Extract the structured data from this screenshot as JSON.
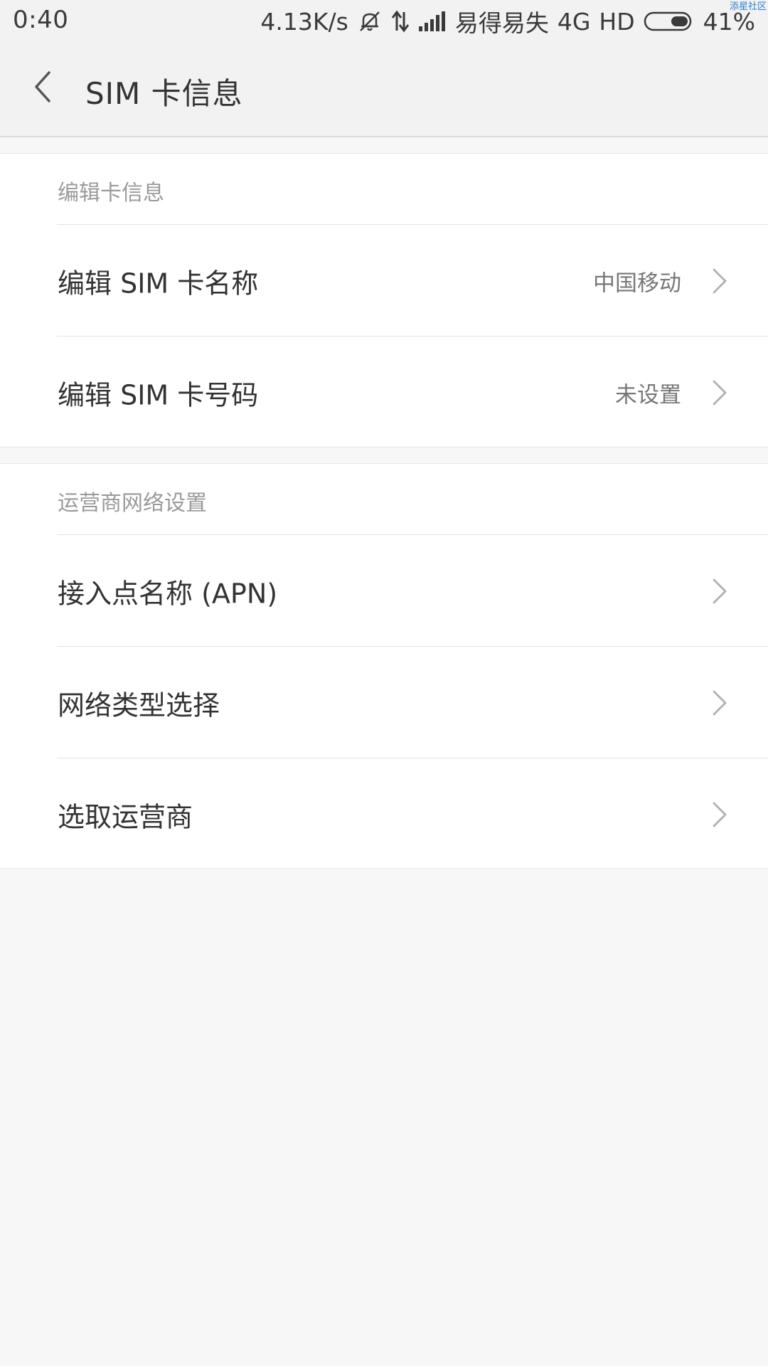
{
  "status_bar": {
    "time": "0:40",
    "network_speed": "4.13K/s",
    "icons": [
      "mute-alarm-icon",
      "data-transfer-icon",
      "signal-icon"
    ],
    "carrier": "易得易失",
    "network_type": "4G",
    "hd": "HD",
    "battery_percent": "41%",
    "battery_level": 0.41,
    "watermark": "添星社区"
  },
  "header": {
    "back_icon": "chevron-left-icon",
    "title": "SIM 卡信息"
  },
  "sections": [
    {
      "header": "编辑卡信息",
      "items": [
        {
          "label": "编辑 SIM 卡名称",
          "value": "中国移动",
          "icon": "chevron-right-icon"
        },
        {
          "label": "编辑 SIM 卡号码",
          "value": "未设置",
          "icon": "chevron-right-icon"
        }
      ]
    },
    {
      "header": "运营商网络设置",
      "items": [
        {
          "label": "接入点名称 (APN)",
          "value": "",
          "icon": "chevron-right-icon"
        },
        {
          "label": "网络类型选择",
          "value": "",
          "icon": "chevron-right-icon"
        },
        {
          "label": "选取运营商",
          "value": "",
          "icon": "chevron-right-icon"
        }
      ]
    }
  ],
  "colors": {
    "background": "#f7f7f7",
    "card": "#ffffff",
    "header_bg": "#f2f2f2",
    "primary_text": "#333333",
    "secondary_text": "#9a9a9a",
    "divider": "#e3e3e3",
    "chevron": "#b0b0b0"
  }
}
